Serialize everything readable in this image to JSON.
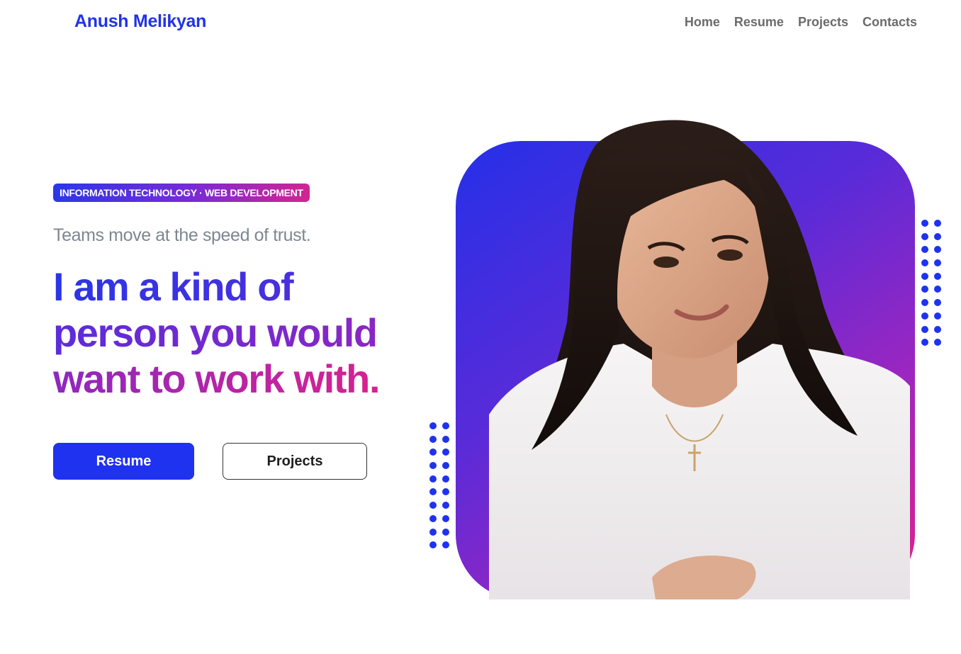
{
  "header": {
    "brand": "Anush Melikyan",
    "nav": [
      "Home",
      "Resume",
      "Projects",
      "Contacts"
    ]
  },
  "hero": {
    "badge": "INFORMATION TECHNOLOGY · WEB DEVELOPMENT",
    "tagline": "Teams move at the speed of trust.",
    "headline": [
      "I am a kind of",
      "person you would",
      "want to work with."
    ],
    "buttons": {
      "resume": "Resume",
      "projects": "Projects"
    }
  },
  "colors": {
    "brand": "#2233e6",
    "primary_button": "#1f32ef",
    "gradient_start": "#2530e8",
    "gradient_end": "#e4218a",
    "nav_text": "#6b6b6b"
  },
  "images": {
    "portrait": "portrait-photo"
  }
}
